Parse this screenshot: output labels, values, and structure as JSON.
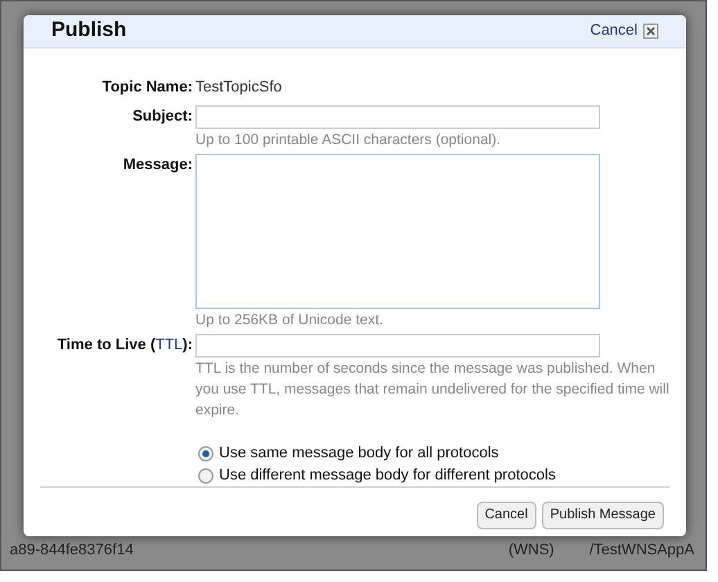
{
  "background_row": {
    "cells": [
      "a89-844fe8376f14",
      "(WNS)",
      "/TestWNSAppA"
    ]
  },
  "dialog": {
    "title": "Publish",
    "close_link": "Cancel",
    "fields": [
      {
        "kind": "static",
        "label": "Topic Name:",
        "value": "TestTopicSfo"
      },
      {
        "kind": "input",
        "label": "Subject:",
        "hint": "Up to 100 printable ASCII characters (optional)."
      },
      {
        "kind": "textarea",
        "label": "Message:",
        "hint": "Up to 256KB of Unicode text."
      },
      {
        "kind": "input",
        "label": "Time to Live (",
        "label_link": "TTL",
        "label_end": "):",
        "hint": "TTL is the number of seconds since the message was published. When you use TTL, messages that remain undelivered for the specified time will expire."
      }
    ],
    "options": [
      {
        "label": "Use same message body for all protocols",
        "selected": true
      },
      {
        "label": "Use different message body for different protocols",
        "selected": false
      }
    ],
    "buttons": [
      "Cancel",
      "Publish Message"
    ]
  }
}
